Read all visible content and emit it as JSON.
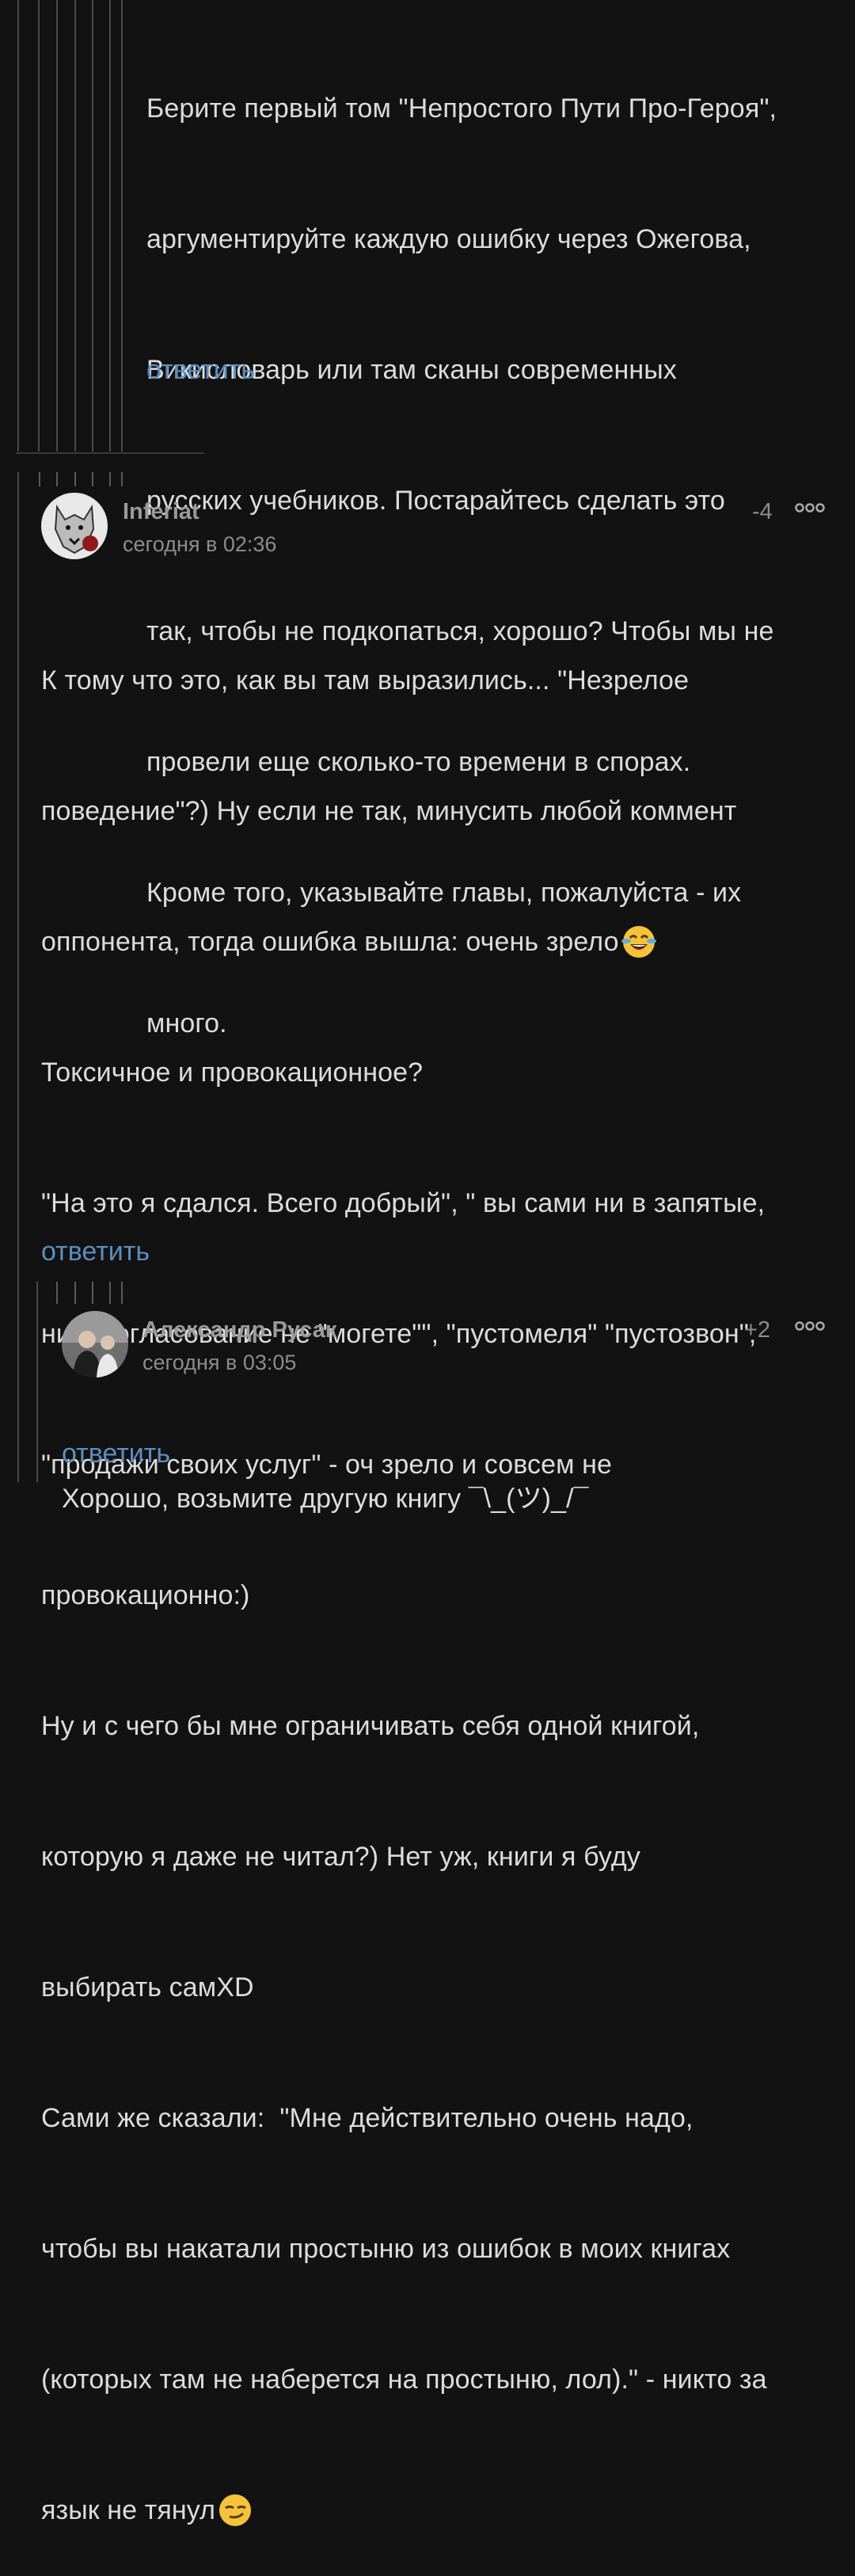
{
  "comment_top": {
    "lines": [
      "Берите первый том \"Непростого Пути Про-Героя\",",
      "аргументируйте каждую ошибку через Ожегова,",
      "Викисловарь или там сканы современных",
      "русских учебников. Постарайтесь сделать это",
      "так, чтобы не подкопаться, хорошо? Чтобы мы не",
      "провели еще сколько-то времени в спорах.",
      "Кроме того, указывайте главы, пожалуйста - их",
      "много."
    ],
    "reply_label": "ответить"
  },
  "comment_inferiat": {
    "author": "Inferiat",
    "time": "сегодня в 02:36",
    "rating": "-4",
    "more_icon": "more-dots-icon",
    "lines": [
      "К тому что это, как вы там выразились... \"Незрелое",
      "поведение\"?) Ну если не так, минусить любой коммент",
      "оппонента, тогда ошибка вышла: очень зрело",
      "Токсичное и провокационное?",
      "\"На это я сдался. Всего добрый\", \" вы сами ни в запятые,",
      "ни в согласование не \"могете\"\", \"пустомеля\" \"пустозвон\",",
      "\"продажи своих услуг\" - оч зрело и совсем не",
      "провокационно:)",
      "Ну и с чего бы мне ограничивать себя одной книгой,",
      "которую я даже не читал?) Нет уж, книги я буду",
      "выбирать самXD",
      "Сами же сказали:  \"Мне действительно очень надо,",
      "чтобы вы накатали простыню из ошибок в моих книгах",
      "(которых там не наберется на простыню, лол).\" - никто за",
      "язык не тянул"
    ],
    "reply_label": "ответить"
  },
  "comment_rusak": {
    "author": "Александр Русак",
    "time": "сегодня в 03:05",
    "rating": "+2",
    "more_icon": "more-dots-icon",
    "lines": [
      "Хорошо, возьмите другую книгу ¯\\_(ツ)_/¯"
    ],
    "reply_label": "ответить"
  },
  "colors": {
    "background": "#121212",
    "text": "#dcdcdc",
    "link": "#5b8ec1",
    "muted": "#8c8c8c",
    "thread_line": "#4a4a4a"
  }
}
